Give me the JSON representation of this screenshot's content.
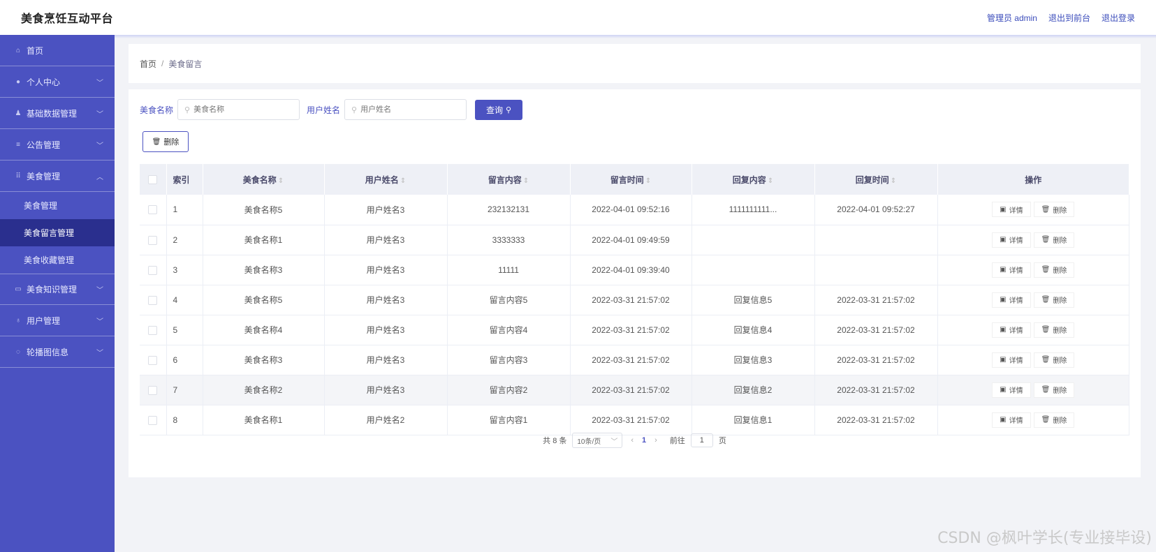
{
  "header": {
    "title": "美食烹饪互动平台",
    "admin_label": "管理员 admin",
    "to_front_label": "退出到前台",
    "logout_label": "退出登录"
  },
  "sidebar": {
    "items": [
      {
        "label": "首页",
        "icon": "home-icon",
        "expandable": false
      },
      {
        "label": "个人中心",
        "icon": "user-icon",
        "expandable": true
      },
      {
        "label": "基础数据管理",
        "icon": "data-icon",
        "expandable": true
      },
      {
        "label": "公告管理",
        "icon": "list-icon",
        "expandable": true
      },
      {
        "label": "美食管理",
        "icon": "grid-icon",
        "expandable": true,
        "expanded": true,
        "sub": [
          "美食管理",
          "美食留言管理",
          "美食收藏管理"
        ]
      },
      {
        "label": "美食知识管理",
        "icon": "card-icon",
        "expandable": true
      },
      {
        "label": "用户管理",
        "icon": "bell-icon",
        "expandable": true
      },
      {
        "label": "轮播图信息",
        "icon": "image-icon",
        "expandable": true
      }
    ],
    "active_sub": "美食留言管理"
  },
  "breadcrumb": {
    "home": "首页",
    "separator": "/",
    "current": "美食留言"
  },
  "search": {
    "food_label": "美食名称",
    "food_placeholder": "美食名称",
    "user_label": "用户姓名",
    "user_placeholder": "用户姓名",
    "query_label": "查询"
  },
  "toolbar": {
    "delete_label": "删除"
  },
  "table": {
    "columns": [
      "索引",
      "美食名称",
      "用户姓名",
      "留言内容",
      "留言时间",
      "回复内容",
      "回复时间",
      "操作"
    ],
    "rows": [
      {
        "index": "1",
        "food": "美食名称5",
        "user": "用户姓名3",
        "content": "232132131",
        "time": "2022-04-01 09:52:16",
        "reply": "1111111111...",
        "reply_time": "2022-04-01 09:52:27"
      },
      {
        "index": "2",
        "food": "美食名称1",
        "user": "用户姓名3",
        "content": "3333333",
        "time": "2022-04-01 09:49:59",
        "reply": "",
        "reply_time": ""
      },
      {
        "index": "3",
        "food": "美食名称3",
        "user": "用户姓名3",
        "content": "11111",
        "time": "2022-04-01 09:39:40",
        "reply": "",
        "reply_time": ""
      },
      {
        "index": "4",
        "food": "美食名称5",
        "user": "用户姓名3",
        "content": "留言内容5",
        "time": "2022-03-31 21:57:02",
        "reply": "回复信息5",
        "reply_time": "2022-03-31 21:57:02"
      },
      {
        "index": "5",
        "food": "美食名称4",
        "user": "用户姓名3",
        "content": "留言内容4",
        "time": "2022-03-31 21:57:02",
        "reply": "回复信息4",
        "reply_time": "2022-03-31 21:57:02"
      },
      {
        "index": "6",
        "food": "美食名称3",
        "user": "用户姓名3",
        "content": "留言内容3",
        "time": "2022-03-31 21:57:02",
        "reply": "回复信息3",
        "reply_time": "2022-03-31 21:57:02"
      },
      {
        "index": "7",
        "food": "美食名称2",
        "user": "用户姓名3",
        "content": "留言内容2",
        "time": "2022-03-31 21:57:02",
        "reply": "回复信息2",
        "reply_time": "2022-03-31 21:57:02"
      },
      {
        "index": "8",
        "food": "美食名称1",
        "user": "用户姓名2",
        "content": "留言内容1",
        "time": "2022-03-31 21:57:02",
        "reply": "回复信息1",
        "reply_time": "2022-03-31 21:57:02"
      }
    ],
    "highlighted_row": 6,
    "detail_label": "详情",
    "delete_label": "删除"
  },
  "pagination": {
    "total_text": "共 8 条",
    "page_size": "10条/页",
    "current_page": "1",
    "goto_label": "前往",
    "goto_value": "1",
    "page_unit": "页"
  },
  "watermark": "CSDN @枫叶学长(专业接毕设)",
  "colors": {
    "accent": "#4b52c1",
    "sidebar_active": "#2a2f8e",
    "header_bg": "#ffffff",
    "page_bg": "#f2f3f7"
  }
}
